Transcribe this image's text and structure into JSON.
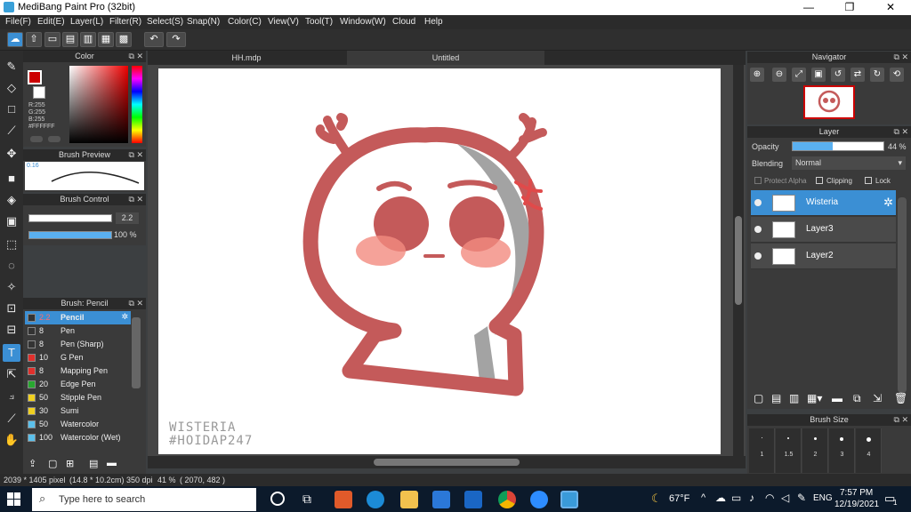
{
  "window": {
    "title": "MediBang Paint Pro (32bit)",
    "minimize": "—",
    "maximize": "❐",
    "close": "✕"
  },
  "menu": [
    "File(F)",
    "Edit(E)",
    "Layer(L)",
    "Filter(R)",
    "Select(S)",
    "Snap(N)",
    "Color(C)",
    "View(V)",
    "Tool(T)",
    "Window(W)",
    "Cloud",
    "Help"
  ],
  "color_panel": {
    "title": "Color",
    "r": "R:255",
    "g": "G:255",
    "b": "B:255",
    "hex": "#FFFFFF"
  },
  "brush_preview": {
    "title": "Brush Preview",
    "value": "0.16"
  },
  "brush_control": {
    "title": "Brush Control",
    "size": "2.2",
    "opacity": "100 %"
  },
  "brush_list": {
    "title": "Brush: Pencil",
    "items": [
      {
        "size": "2.2",
        "name": "Pencil",
        "color": "#333333"
      },
      {
        "size": "8",
        "name": "Pen",
        "color": "#333333"
      },
      {
        "size": "8",
        "name": "Pen (Sharp)",
        "color": "#333333"
      },
      {
        "size": "10",
        "name": "G Pen",
        "color": "#e0302c"
      },
      {
        "size": "8",
        "name": "Mapping Pen",
        "color": "#e0302c"
      },
      {
        "size": "20",
        "name": "Edge Pen",
        "color": "#28a830"
      },
      {
        "size": "50",
        "name": "Stipple Pen",
        "color": "#f0d020"
      },
      {
        "size": "30",
        "name": "Sumi",
        "color": "#f0d020"
      },
      {
        "size": "50",
        "name": "Watercolor",
        "color": "#5bc0eb"
      },
      {
        "size": "100",
        "name": "Watercolor (Wet)",
        "color": "#5bc0eb"
      }
    ]
  },
  "tabs": [
    "HH.mdp",
    "Untitled"
  ],
  "artwork": {
    "caption_1": "WISTERIA",
    "caption_2": "#HOIDAP247"
  },
  "navigator": {
    "title": "Navigator"
  },
  "layer_panel": {
    "title": "Layer",
    "opacity_label": "Opacity",
    "opacity_value": "44 %",
    "opacity": 0.44,
    "blending_label": "Blending",
    "blending_value": "Normal",
    "protect_alpha": "Protect Alpha",
    "clipping": "Clipping",
    "lock": "Lock",
    "layers": [
      {
        "name": "Wisteria",
        "active": true
      },
      {
        "name": "Layer3",
        "active": false
      },
      {
        "name": "Layer2",
        "active": false
      }
    ]
  },
  "brush_size": {
    "title": "Brush Size",
    "sizes": [
      "1",
      "1.5",
      "2",
      "3",
      "4"
    ]
  },
  "status": {
    "dims": "2039 * 1405 pixel",
    "physical": "(14.8 * 10.2cm)",
    "dpi": "350 dpi",
    "zoom": "41 %",
    "coords": "( 2070, 482 )"
  },
  "taskbar": {
    "search_placeholder": "Type here to search",
    "weather": "67°F",
    "lang": "ENG",
    "time": "7:57 PM",
    "date": "12/19/2021",
    "notif": "1"
  }
}
